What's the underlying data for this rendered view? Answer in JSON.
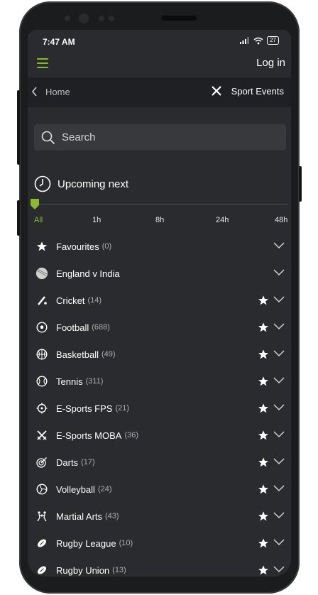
{
  "status_bar": {
    "time": "7:47 AM",
    "battery": "27"
  },
  "header": {
    "menu_icon": "hamburger-icon",
    "login_label": "Log in"
  },
  "breadcrumb": {
    "home_label": "Home",
    "section_label": "Sport Events"
  },
  "search": {
    "placeholder": "Search"
  },
  "upcoming": {
    "title": "Upcoming next"
  },
  "time_filter": {
    "options": [
      "All",
      "1h",
      "8h",
      "24h",
      "48h"
    ],
    "selected": "All"
  },
  "list": {
    "items": [
      {
        "label": "Favourites",
        "count": "(0)",
        "icon": "star-icon",
        "favourite_toggle": false
      },
      {
        "label": "England v India",
        "count": "",
        "icon": "ball-icon",
        "favourite_toggle": false
      },
      {
        "label": "Cricket",
        "count": "(14)",
        "icon": "cricket-icon",
        "favourite_toggle": true
      },
      {
        "label": "Football",
        "count": "(688)",
        "icon": "football-icon",
        "favourite_toggle": true
      },
      {
        "label": "Basketball",
        "count": "(49)",
        "icon": "basketball-icon",
        "favourite_toggle": true
      },
      {
        "label": "Tennis",
        "count": "(311)",
        "icon": "tennis-icon",
        "favourite_toggle": true
      },
      {
        "label": "E-Sports FPS",
        "count": "(21)",
        "icon": "crosshair-icon",
        "favourite_toggle": true
      },
      {
        "label": "E-Sports MOBA",
        "count": "(36)",
        "icon": "crossed-swords-icon",
        "favourite_toggle": true
      },
      {
        "label": "Darts",
        "count": "(17)",
        "icon": "dartboard-icon",
        "favourite_toggle": true
      },
      {
        "label": "Volleyball",
        "count": "(24)",
        "icon": "volleyball-icon",
        "favourite_toggle": true
      },
      {
        "label": "Martial Arts",
        "count": "(43)",
        "icon": "martial-arts-icon",
        "favourite_toggle": true
      },
      {
        "label": "Rugby League",
        "count": "(10)",
        "icon": "rugby-ball-icon",
        "favourite_toggle": true
      },
      {
        "label": "Rugby Union",
        "count": "(13)",
        "icon": "rugby-ball-icon",
        "favourite_toggle": true
      }
    ]
  },
  "colors": {
    "accent": "#8ab82f",
    "background": "#2a2b2e",
    "breadcrumb_bg": "#1f2023",
    "search_bg": "#38393d"
  }
}
